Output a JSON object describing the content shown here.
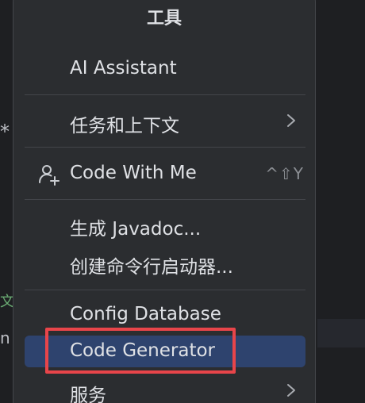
{
  "editor": {
    "glyph_1": "*",
    "glyph_2": "文",
    "glyph_3": "n"
  },
  "menu": {
    "title": "工具",
    "items": [
      {
        "label": "AI Assistant"
      },
      {
        "label": "任务和上下文",
        "icon": "chevron-right-icon"
      },
      {
        "label": "Code With Me",
        "icon": "person-add-icon",
        "shortcut": "^⇧Y"
      },
      {
        "label": "生成 Javadoc..."
      },
      {
        "label": "创建命令行启动器..."
      },
      {
        "label": "Config Database"
      },
      {
        "label": "Code Generator",
        "selected": true
      },
      {
        "label": "服务",
        "icon": "chevron-right-icon"
      }
    ]
  },
  "colors": {
    "menu_bg": "#2b2d30",
    "editor_bg": "#1e1f22",
    "selection": "#2e436e",
    "highlight_box": "#e8454a",
    "text": "#dfe1e5",
    "muted_text": "#8c8f94"
  }
}
